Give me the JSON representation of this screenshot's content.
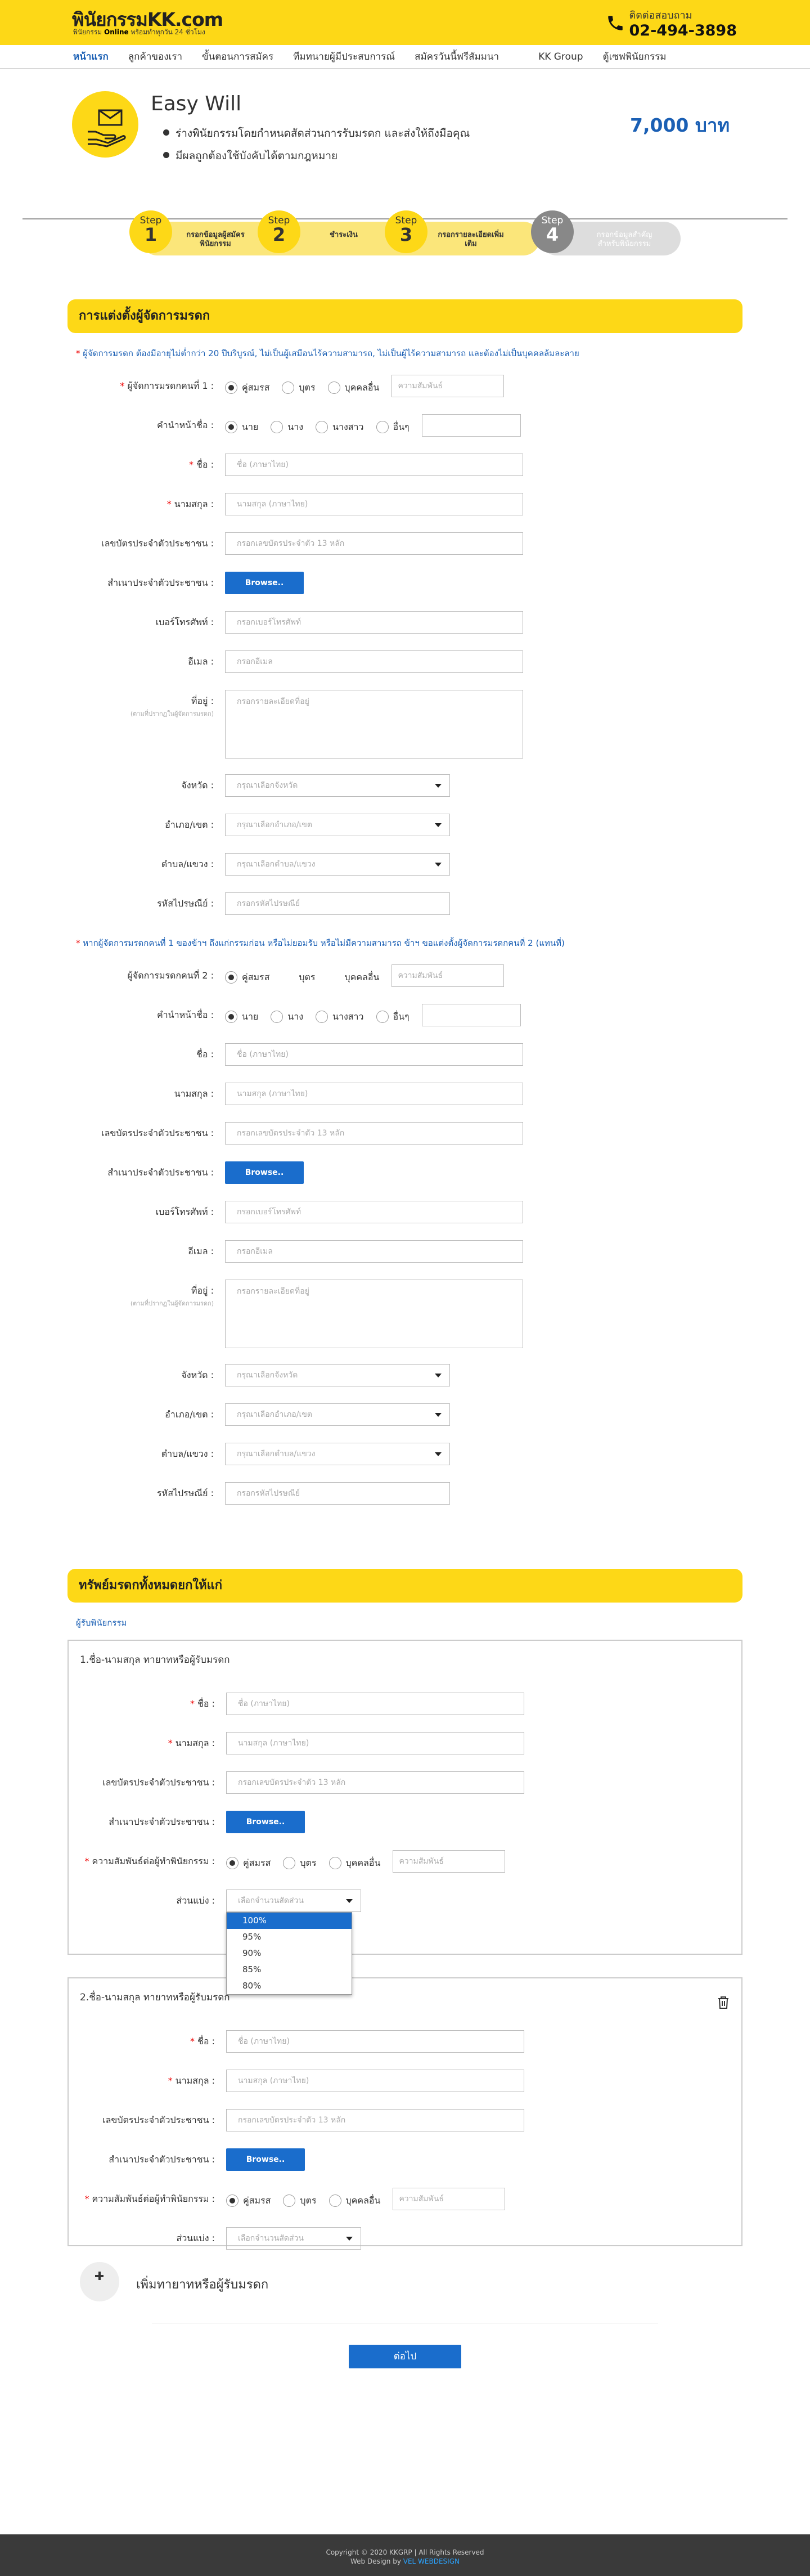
{
  "header": {
    "logo_text": "พินัยกรรม",
    "logo_kk": "KK",
    "logo_com": ".com",
    "logo_sub1": "พินัยกรรม",
    "logo_sub2": "Online",
    "logo_sub3": "พร้อมทำทุกวัน 24 ชั่วโมง",
    "contact_label": "ติดต่อสอบถาม",
    "contact_number": "02-494-3898"
  },
  "nav": [
    "หน้าแรก",
    "ลูกค้าของเรา",
    "ขั้นตอนการสมัคร",
    "ทีมทนายผู้มีประสบการณ์",
    "สมัครวันนี้ฟรีสัมมนา",
    "KK Group",
    "ตู้เซฟพินัยกรรม"
  ],
  "product": {
    "title": "Easy Will",
    "bullets": [
      "ร่างพินัยกรรมโดยกำหนดสัดส่วนการรับมรดก และส่งให้ถึงมือคุณ",
      "มีผลถูกต้องใช้บังคับได้ตามกฎหมาย"
    ],
    "price": "7,000 บาท"
  },
  "steps": [
    {
      "step": "Step",
      "num": "1",
      "label": "กรอกข้อมูลผู้สมัครพินัยกรรม"
    },
    {
      "step": "Step",
      "num": "2",
      "label": "ชำระเงิน"
    },
    {
      "step": "Step",
      "num": "3",
      "label": "กรอกรายละเอียดเพิ่มเติม"
    },
    {
      "step": "Step",
      "num": "4",
      "label": "กรอกข้อมูลสำคัญ สำหรับพินัยกรรม"
    }
  ],
  "sec1": {
    "title": "การแต่งตั้งผู้จัดการมรดก",
    "note": "ผู้จัดการมรดก ต้องมีอายุไม่ต่ำกว่า 20 ปีบริบูรณ์, ไม่เป็นผู้เสมือนไร้ความสามารถ, ไม่เป็นผู้ไร้ความสามารถ และต้องไม่เป็นบุคคลล้มละลาย",
    "note2": "หากผู้จัดการมรดกคนที่ 1 ของข้าฯ ถึงแก่กรรมก่อน หรือไม่ยอมรับ หรือไม่มีความสามารถ ข้าฯ ขอแต่งตั้งผู้จัดการมรดกคนที่ 2 (แทนที่)"
  },
  "labels": {
    "exec1": "ผู้จัดการมรดกคนที่ 1 :",
    "exec2": "ผู้จัดการมรดกคนที่ 2 :",
    "title": "คำนำหน้าชื่อ :",
    "fname": "ชื่อ :",
    "lname": "นามสกุล :",
    "idcard": "เลขบัตรประจำตัวประชาชน :",
    "idcopy": "สำเนาประจำตัวประชาชน :",
    "phone": "เบอร์โทรศัพท์ :",
    "email": "อีเมล :",
    "address": "ที่อยู่ :",
    "address_hint": "(ตามที่ปรากฏในผู้จัดการมรดก)",
    "province": "จังหวัด :",
    "district": "อำเภอ/เขต :",
    "subdistrict": "ตำบล/แขวง :",
    "zip": "รหัสไปรษณีย์ :",
    "relation": "ความสัมพันธ์ต่อผู้ทำพินัยกรรม :",
    "share": "ส่วนแบ่ง :"
  },
  "opts": {
    "spouse": "คู่สมรส",
    "child": "บุตร",
    "other": "บุคคลอื่น",
    "relation_ph": "ความสัมพันธ์",
    "mr": "นาย",
    "mrs": "นาง",
    "miss": "นางสาว",
    "others": "อื่นๆ",
    "browse": "Browse.."
  },
  "ph": {
    "fname": "ชื่อ (ภาษาไทย)",
    "lname": "นามสกุล (ภาษาไทย)",
    "idcard": "กรอกเลขบัตรประจำตัว 13 หลัก",
    "phone": "กรอกเบอร์โทรศัพท์",
    "email": "กรอกอีเมล",
    "address": "กรอกรายละเอียดที่อยู่",
    "province": "กรุณาเลือกจังหวัด",
    "district": "กรุณาเลือกอำเภอ/เขต",
    "subdistrict": "กรุณาเลือกตำบล/แขวง",
    "zip": "กรอกรหัสไปรษณีย์",
    "share": "เลือกจำนวนสัดส่วน"
  },
  "sec2": {
    "title": "ทรัพย์มรดกทั้งหมดยกให้แก่",
    "sub": "ผู้รับพินัยกรรม",
    "heir1": "1.ชื่อ-นามสกุล ทายาทหรือผู้รับมรดก",
    "heir2": "2.ชื่อ-นามสกุล ทายาทหรือผู้รับมรดก",
    "share_options": [
      "100%",
      "95%",
      "90%",
      "85%",
      "80%"
    ],
    "add_heir": "เพิ่มทายาทหรือผู้รับมรดก",
    "next": "ต่อไป"
  },
  "footer": {
    "copy": "Copyright © 2020 KKGRP | All Rights Reserved",
    "design": "Web Design by",
    "designer": "VEL WEBDESIGN"
  },
  "colors": {
    "brand_yellow": "#fdd817",
    "accent_blue": "#1a6dcc"
  }
}
